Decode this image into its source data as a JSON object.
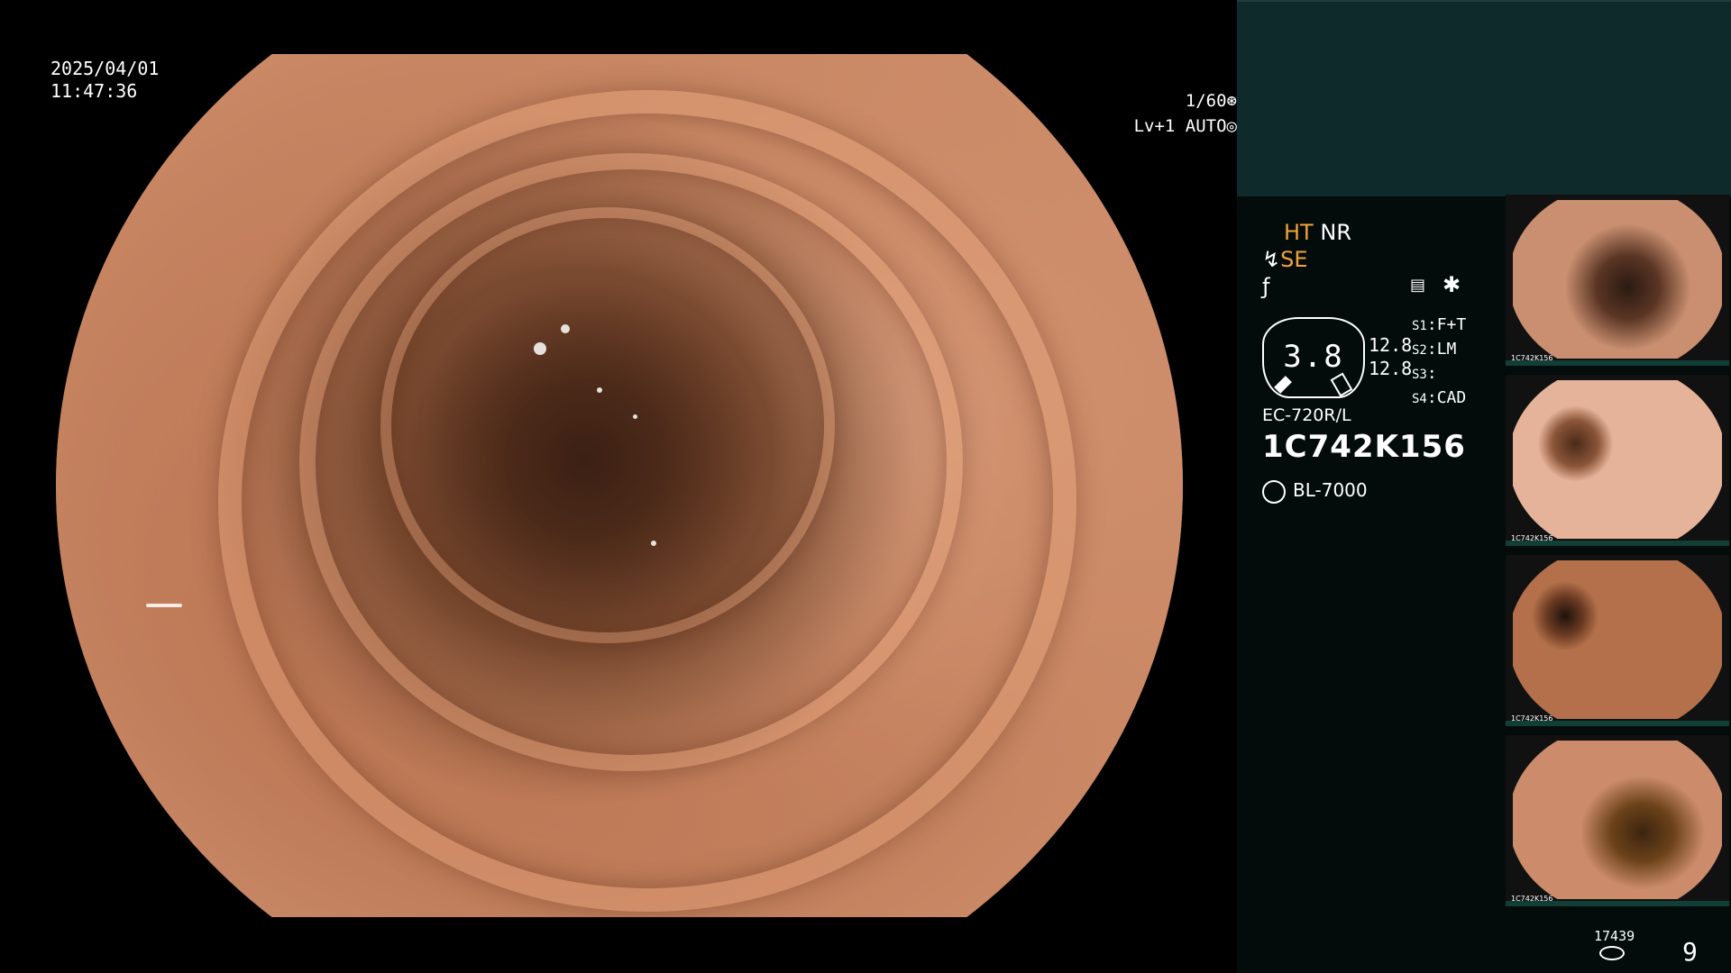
{
  "overlay": {
    "date": "2025/04/01",
    "time": "11:47:36",
    "exposure_line1": "1/60⊛",
    "exposure_line2": "Lv+1 AUTO◎"
  },
  "panel": {
    "ht": "HT",
    "nr": "NR",
    "se": "SE",
    "se_icon": "scope-curve-icon",
    "filter_icon": "f-hook-icon",
    "gauge_value": "3.8",
    "num1": "12.8",
    "num2": "12.8",
    "slots": [
      {
        "key": "S1",
        "value": "F+T"
      },
      {
        "key": "S2",
        "value": "LM"
      },
      {
        "key": "S3",
        "value": ""
      },
      {
        "key": "S4",
        "value": "CAD"
      }
    ],
    "scope_model": "EC-720R/L",
    "serial": "1C742K156",
    "light_source": "BL-7000",
    "counter": "17439",
    "page": "9"
  },
  "thumbnails": [
    {
      "caption": "1C742K156"
    },
    {
      "caption": "1C742K156"
    },
    {
      "caption": "1C742K156"
    },
    {
      "caption": "1C742K156"
    }
  ],
  "colors": {
    "accent_orange": "#f2a23a",
    "panel_bg": "#030b0b",
    "top_box": "#0f2a2a"
  }
}
